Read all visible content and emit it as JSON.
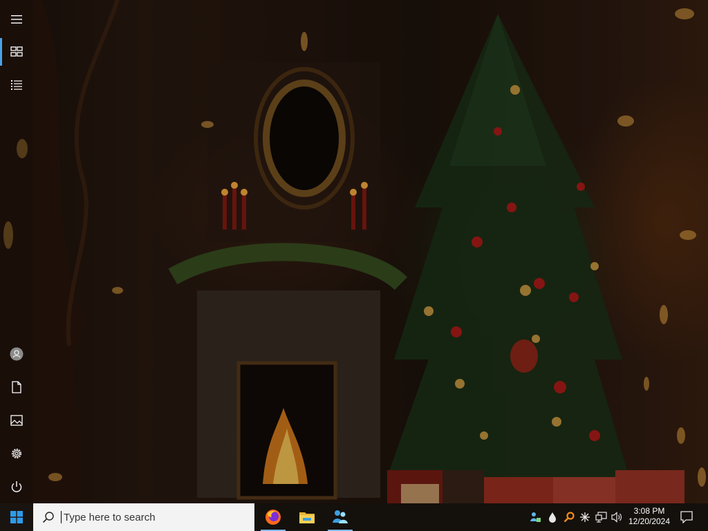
{
  "desktop": {
    "wallpaper": "christmas-fireplace-tree-wallpaper"
  },
  "start_rail": {
    "items": [
      {
        "name": "menu-icon"
      },
      {
        "name": "tiles-icon",
        "active": true
      },
      {
        "name": "all-apps-list-icon"
      },
      {
        "name": "user-avatar-icon"
      },
      {
        "name": "documents-icon"
      },
      {
        "name": "pictures-icon"
      },
      {
        "name": "settings-gear-icon"
      },
      {
        "name": "power-icon"
      }
    ],
    "accent": "#4aa3e8"
  },
  "taskbar": {
    "start_icon": "windows-logo-icon",
    "search": {
      "placeholder": "Type here to search"
    },
    "apps": [
      {
        "name": "firefox",
        "icon": "firefox-icon",
        "running": true
      },
      {
        "name": "file-explorer",
        "icon": "folder-icon",
        "running": false
      },
      {
        "name": "people-app",
        "icon": "people-icon",
        "running": true
      }
    ],
    "tray": {
      "icons": [
        "people-network-icon",
        "water-drop-icon",
        "search-key-icon",
        "sparkle-icon",
        "network-icon",
        "volume-icon"
      ],
      "time": "3:08 PM",
      "date": "12/20/2024",
      "notification_icon": "action-center-icon"
    }
  }
}
